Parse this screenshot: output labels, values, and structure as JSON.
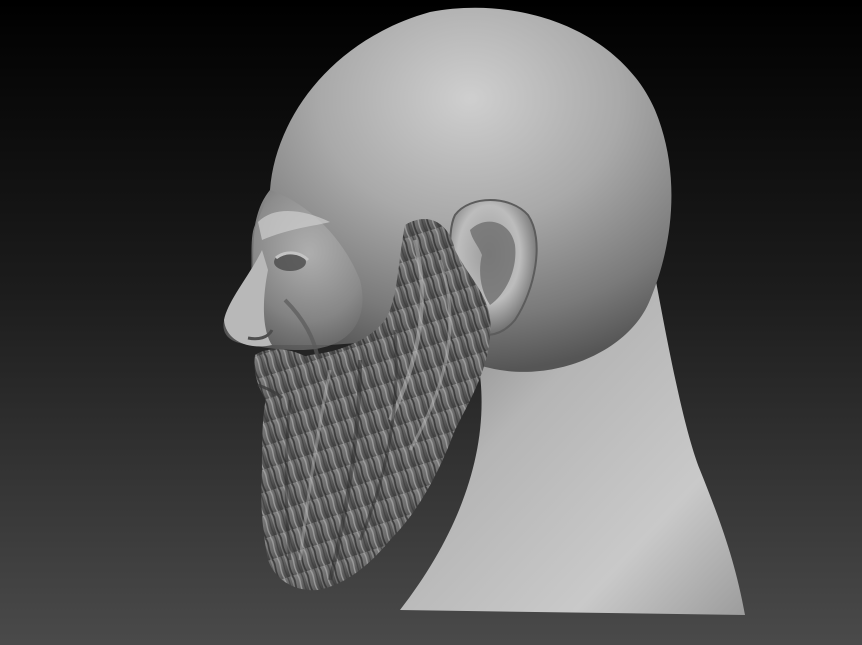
{
  "scene": {
    "subject": "sculpted-head-profile",
    "background_colors": {
      "top": "#000000",
      "bottom": "#4a4a4a"
    },
    "material_colors": {
      "highlight": "#d6d6d6",
      "mid": "#9a9a9a",
      "shadow": "#3a3a3a",
      "beard_light": "#a8a8a8",
      "beard_dark": "#2e2e2e"
    }
  }
}
